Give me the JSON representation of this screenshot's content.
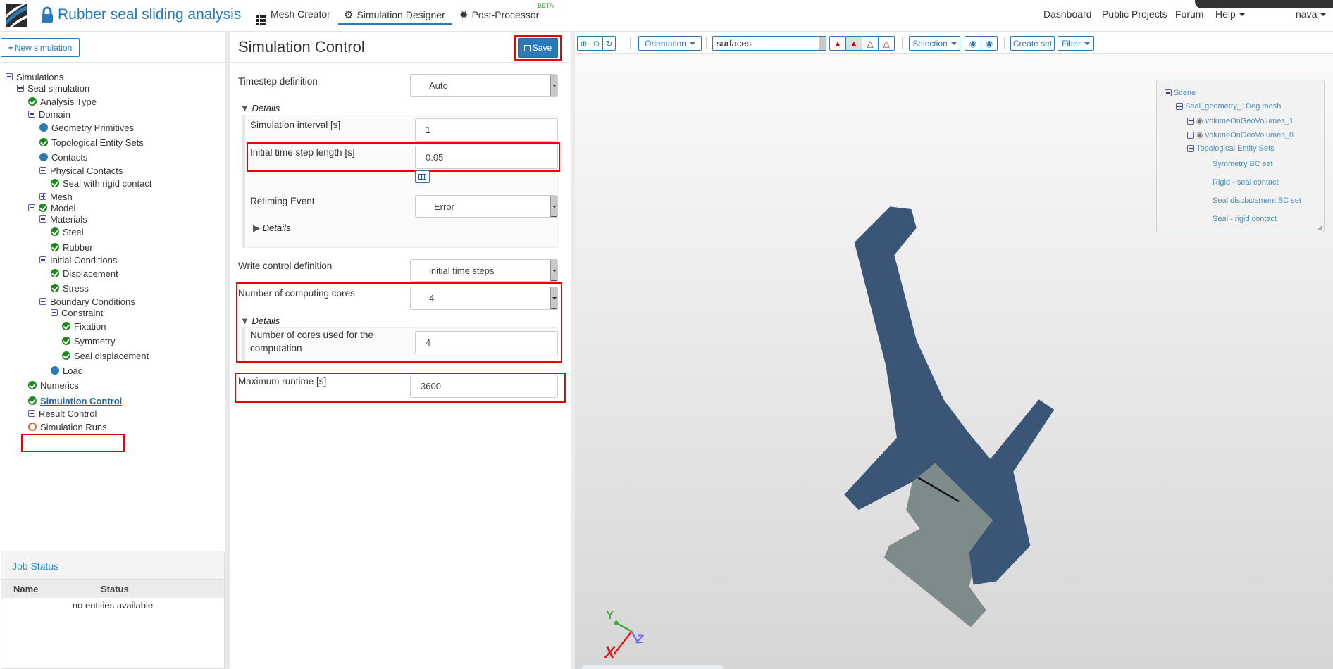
{
  "header": {
    "project_title": "Rubber seal sliding analysis",
    "tabs": [
      {
        "label": "Mesh Creator"
      },
      {
        "label": "Simulation Designer",
        "active": true
      },
      {
        "label": "Post-Processor",
        "badge": "BETA"
      }
    ],
    "right_nav": [
      "Dashboard",
      "Public Projects",
      "Forum",
      "Help"
    ],
    "user": "nava"
  },
  "left": {
    "new_simulation_label": "New simulation",
    "tree": [
      {
        "label": "Simulations",
        "icon": "minus"
      },
      {
        "label": "Seal simulation",
        "icon": "minus"
      },
      {
        "label": "Analysis Type",
        "icon": "check"
      },
      {
        "label": "Domain",
        "icon": "minus"
      },
      {
        "label": "Geometry Primitives",
        "icon": "dot"
      },
      {
        "label": "Topological Entity Sets",
        "icon": "check"
      },
      {
        "label": "Contacts",
        "icon": "dot"
      },
      {
        "label": "Physical Contacts",
        "icon": "minus"
      },
      {
        "label": "Seal with rigid contact",
        "icon": "check"
      },
      {
        "label": "Mesh",
        "icon": "plus"
      },
      {
        "label": "Model",
        "icon": "minus+check"
      },
      {
        "label": "Materials",
        "icon": "minus"
      },
      {
        "label": "Steel",
        "icon": "check"
      },
      {
        "label": "Rubber",
        "icon": "check"
      },
      {
        "label": "Initial Conditions",
        "icon": "minus"
      },
      {
        "label": "Displacement",
        "icon": "check"
      },
      {
        "label": "Stress",
        "icon": "check"
      },
      {
        "label": "Boundary Conditions",
        "icon": "minus"
      },
      {
        "label": "Constraint",
        "icon": "minus"
      },
      {
        "label": "Fixation",
        "icon": "check"
      },
      {
        "label": "Symmetry",
        "icon": "check"
      },
      {
        "label": "Seal displacement",
        "icon": "check"
      },
      {
        "label": "Load",
        "icon": "dot"
      },
      {
        "label": "Numerics",
        "icon": "check"
      },
      {
        "label": "Simulation Control",
        "icon": "check",
        "selected": true
      },
      {
        "label": "Result Control",
        "icon": "plus"
      },
      {
        "label": "Simulation Runs",
        "icon": "ring"
      }
    ],
    "job_status": {
      "title": "Job Status",
      "columns": [
        "Name",
        "Status"
      ],
      "empty": "no entities available"
    }
  },
  "form": {
    "title": "Simulation Control",
    "save_label": "Save",
    "timestep_definition": {
      "label": "Timestep definition",
      "value": "Auto"
    },
    "details_label": "Details",
    "simulation_interval": {
      "label": "Simulation interval [s]",
      "value": "1"
    },
    "initial_time_step": {
      "label": "Initial time step length [s]",
      "value": "0.05"
    },
    "retiming_event": {
      "label": "Retiming Event",
      "value": "Error"
    },
    "write_control": {
      "label": "Write control definition",
      "value": "initial time steps"
    },
    "computing_cores": {
      "label": "Number of computing cores",
      "value": "4"
    },
    "cores_used": {
      "label": "Number of cores used for the computation",
      "value": "4"
    },
    "max_runtime": {
      "label": "Maximum runtime [s]",
      "value": "3600"
    }
  },
  "viewer": {
    "toolbar": {
      "orientation": "Orientation",
      "render_mode": "surfaces",
      "selection": "Selection",
      "create_set": "Create set",
      "filter": "Filter"
    },
    "scene": {
      "root": "Scene",
      "mesh": "Seal_geometry_1Deg mesh",
      "volumes": [
        "volumeOnGeoVolumes_1",
        "volumeOnGeoVolumes_0"
      ],
      "sets_label": "Topological Entity Sets",
      "sets": [
        "Symmetry BC set",
        "Rigid - seal contact",
        "Seal displacement BC set",
        "Seal - rigid contact"
      ]
    },
    "axes": {
      "x": "X",
      "y": "Y",
      "z": "Z"
    },
    "colors": {
      "seal": "#3b5577",
      "rigid": "#7e8b8b",
      "x_axis": "#e01818",
      "y_axis": "#3aaa3a",
      "z_axis": "#7070f0"
    }
  }
}
